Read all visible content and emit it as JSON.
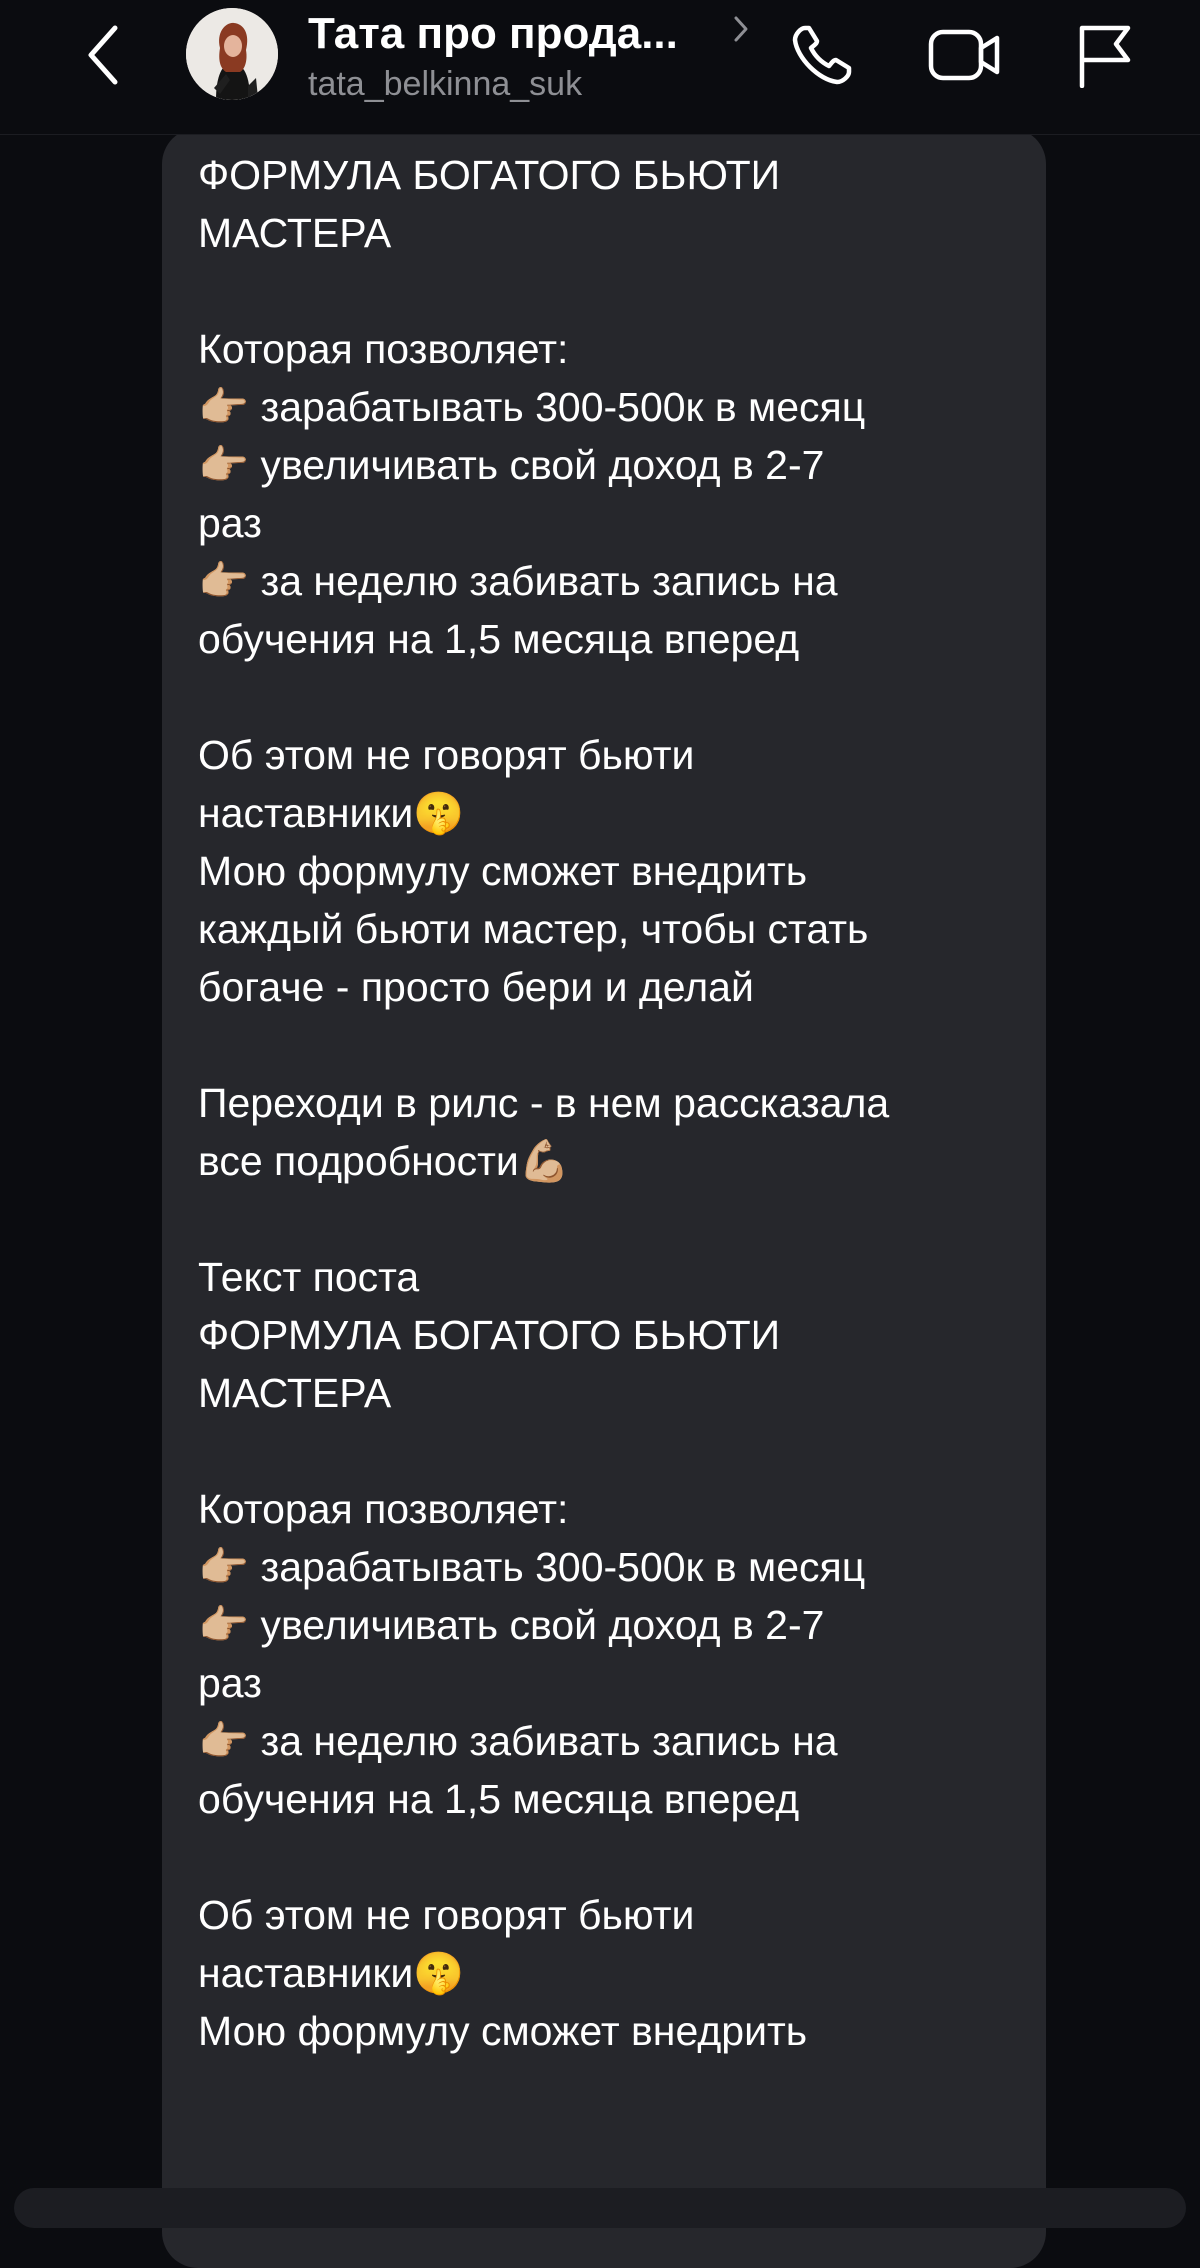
{
  "header": {
    "title": "Тата  про прода...",
    "username": "tata_belkinna_suk",
    "icons": {
      "back": "chevron-left-icon",
      "profile_chevron": "chevron-right-icon",
      "call": "phone-icon",
      "video": "video-camera-icon",
      "report": "flag-icon"
    }
  },
  "message": {
    "text": "ФОРМУЛА БОГАТОГО БЬЮТИ\nМАСТЕРА\n\nКоторая позволяет:\n👉🏼 зарабатывать 300-500к в месяц\n👉🏼 увеличивать свой доход в 2-7\nраз\n👉🏼 за неделю забивать запись на\nобучения на 1,5 месяца вперед\n\nОб этом не говорят бьюти\nнаставники🤫\nМою формулу сможет внедрить\nкаждый бьюти мастер, чтобы стать\nбогаче - просто бери и делай\n\nПереходи в рилс - в нем рассказала\nвсе подробности💪🏼\n\nТекст поста\nФОРМУЛА БОГАТОГО БЬЮТИ\nМАСТЕРА\n\nКоторая позволяет:\n👉🏼 зарабатывать 300-500к в месяц\n👉🏼 увеличивать свой доход в 2-7\nраз\n👉🏼 за неделю забивать запись на\nобучения на 1,5 месяца вперед\n\nОб этом не говорят бьюти\nнаставники🤫\nМою формулу сможет внедрить"
  },
  "colors": {
    "background": "#0b0c10",
    "bubble": "#26272c",
    "text": "#ffffff",
    "subtitle": "#8e8f94"
  }
}
